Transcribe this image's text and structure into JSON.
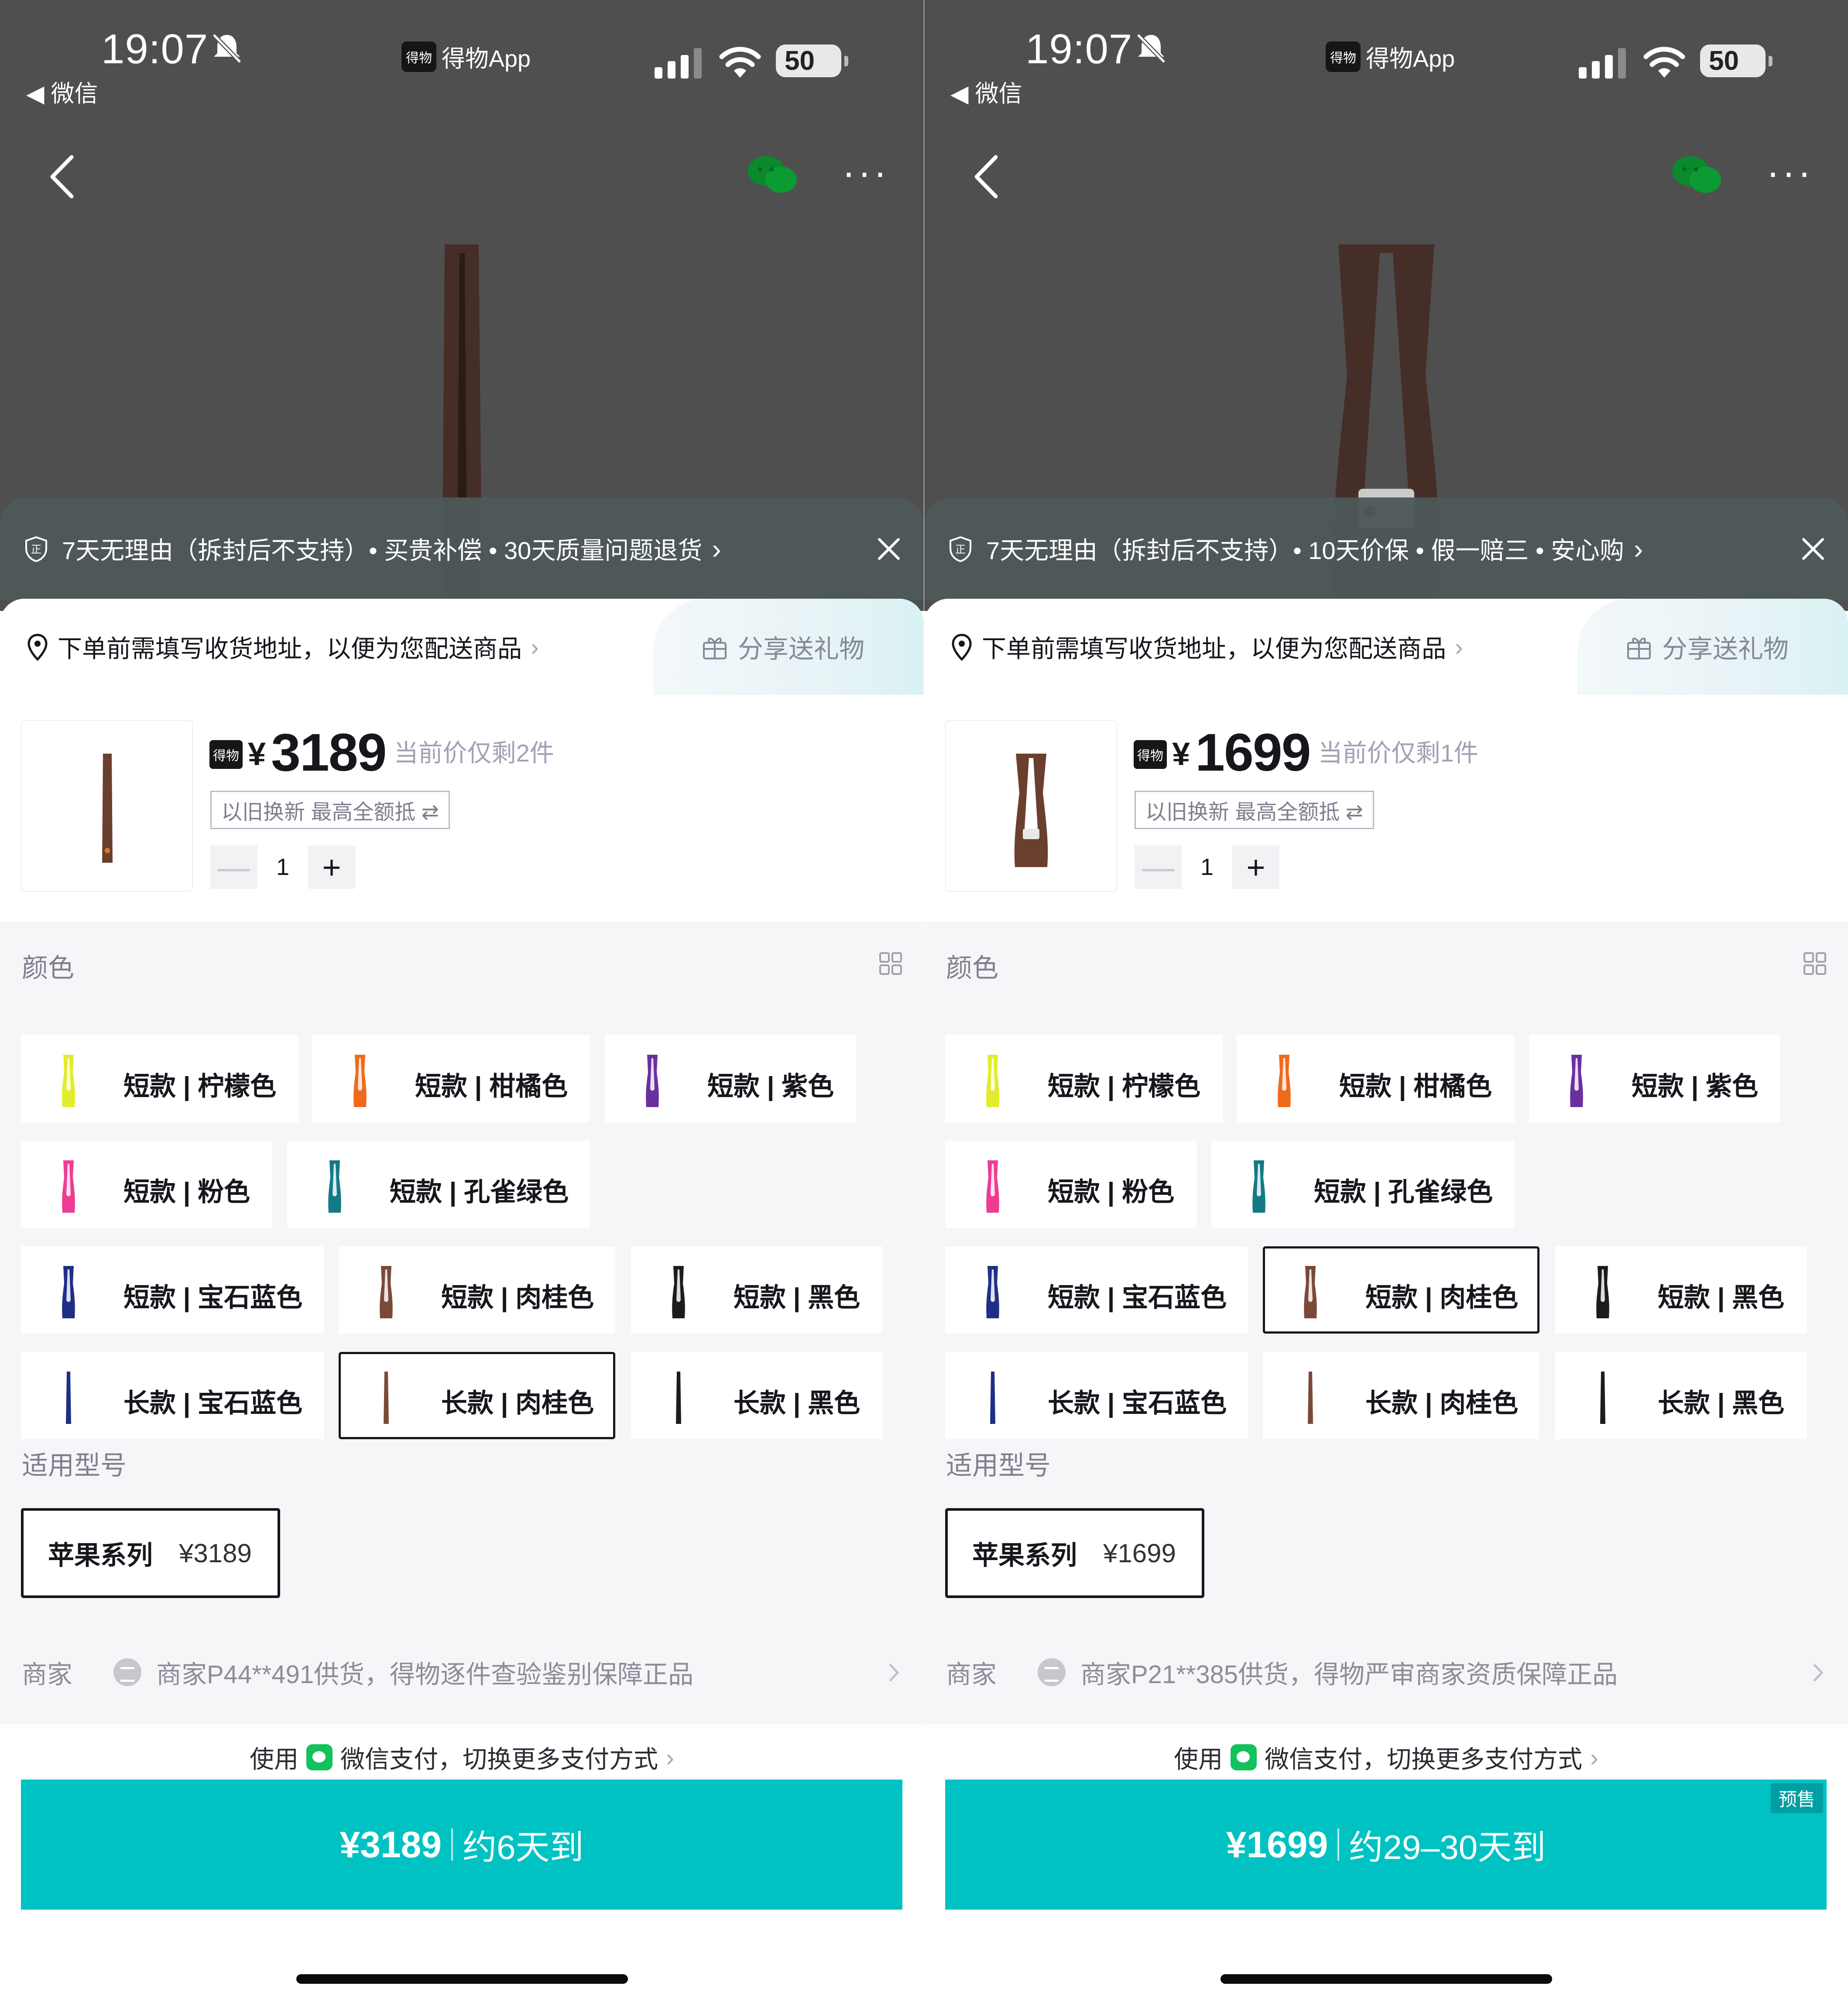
{
  "panels": [
    {
      "status": {
        "time": "19:07",
        "back_app": "◀ 微信",
        "app_name": "得物App",
        "app_logo_text": "得物",
        "battery": "50"
      },
      "guarantee": {
        "text": "7天无理由（拆封后不支持）• 买贵补偿 • 30天质量问题退货",
        "chevron": "›"
      },
      "address": {
        "text": "下单前需填写收货地址，以便为您配送商品",
        "chevron": "›"
      },
      "share": {
        "label": "分享送礼物"
      },
      "product": {
        "logo_text": "得物",
        "currency": "¥",
        "price": "3189",
        "remaining": "当前价仅剩2件",
        "tradein": "以旧换新 最高全额抵 ⇄",
        "qty": "1",
        "minus": "—",
        "plus": "+",
        "thumb_color": "#7a4a38"
      },
      "color_section": {
        "title": "颜色"
      },
      "colors": [
        {
          "label": "短款 | 柠檬色",
          "swatch": "#e2ec2a",
          "selected": false
        },
        {
          "label": "短款 | 柑橘色",
          "swatch": "#f06a1c",
          "selected": false
        },
        {
          "label": "短款 | 紫色",
          "swatch": "#6c2fa0",
          "selected": false
        },
        {
          "label": "短款 | 粉色",
          "swatch": "#ef3c93",
          "selected": false
        },
        {
          "label": "短款 | 孔雀绿色",
          "swatch": "#137a86",
          "selected": false
        },
        {
          "label": "短款 | 宝石蓝色",
          "swatch": "#1f2f85",
          "selected": false
        },
        {
          "label": "短款 | 肉桂色",
          "swatch": "#7a4a38",
          "selected": false
        },
        {
          "label": "短款 | 黑色",
          "swatch": "#1c1c1c",
          "selected": false
        },
        {
          "label": "长款 | 宝石蓝色",
          "swatch": "#1f2f85",
          "selected": false
        },
        {
          "label": "长款 | 肉桂色",
          "swatch": "#7a4a38",
          "selected": true
        },
        {
          "label": "长款 | 黑色",
          "swatch": "#1c1c1c",
          "selected": false
        }
      ],
      "model_section": {
        "title": "适用型号",
        "option_name": "苹果系列",
        "option_price": "¥3189"
      },
      "merchant": {
        "label": "商家",
        "text": "商家P44**491供货，得物逐件查验鉴别保障正品"
      },
      "payment": {
        "prefix": "使用",
        "text": "微信支付，切换更多支付方式",
        "chevron": "›"
      },
      "buy": {
        "price": "¥3189",
        "eta": "约6天到",
        "presale": ""
      }
    },
    {
      "status": {
        "time": "19:07",
        "back_app": "◀ 微信",
        "app_name": "得物App",
        "app_logo_text": "得物",
        "battery": "50"
      },
      "guarantee": {
        "text": "7天无理由（拆封后不支持）• 10天价保 • 假一赔三 • 安心购",
        "chevron": "›"
      },
      "address": {
        "text": "下单前需填写收货地址，以便为您配送商品",
        "chevron": "›"
      },
      "share": {
        "label": "分享送礼物"
      },
      "product": {
        "logo_text": "得物",
        "currency": "¥",
        "price": "1699",
        "remaining": "当前价仅剩1件",
        "tradein": "以旧换新 最高全额抵 ⇄",
        "qty": "1",
        "minus": "—",
        "plus": "+",
        "thumb_color": "#7a4a38"
      },
      "color_section": {
        "title": "颜色"
      },
      "colors": [
        {
          "label": "短款 | 柠檬色",
          "swatch": "#e2ec2a",
          "selected": false
        },
        {
          "label": "短款 | 柑橘色",
          "swatch": "#f06a1c",
          "selected": false
        },
        {
          "label": "短款 | 紫色",
          "swatch": "#6c2fa0",
          "selected": false
        },
        {
          "label": "短款 | 粉色",
          "swatch": "#ef3c93",
          "selected": false
        },
        {
          "label": "短款 | 孔雀绿色",
          "swatch": "#137a86",
          "selected": false
        },
        {
          "label": "短款 | 宝石蓝色",
          "swatch": "#1f2f85",
          "selected": false
        },
        {
          "label": "短款 | 肉桂色",
          "swatch": "#7a4a38",
          "selected": true
        },
        {
          "label": "短款 | 黑色",
          "swatch": "#1c1c1c",
          "selected": false
        },
        {
          "label": "长款 | 宝石蓝色",
          "swatch": "#1f2f85",
          "selected": false
        },
        {
          "label": "长款 | 肉桂色",
          "swatch": "#7a4a38",
          "selected": false
        },
        {
          "label": "长款 | 黑色",
          "swatch": "#1c1c1c",
          "selected": false
        }
      ],
      "model_section": {
        "title": "适用型号",
        "option_name": "苹果系列",
        "option_price": "¥1699"
      },
      "merchant": {
        "label": "商家",
        "text": "商家P21**385供货，得物严审商家资质保障正品"
      },
      "payment": {
        "prefix": "使用",
        "text": "微信支付，切换更多支付方式",
        "chevron": "›"
      },
      "buy": {
        "price": "¥1699",
        "eta": "约29–30天到",
        "presale": "预售"
      }
    }
  ]
}
